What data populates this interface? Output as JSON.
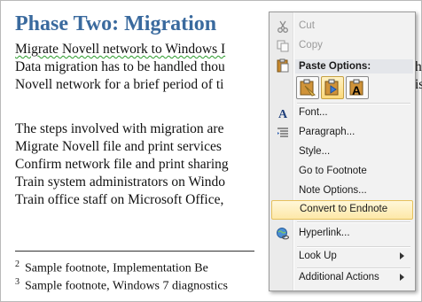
{
  "document": {
    "title": "Phase Two: Migration",
    "lines": [
      "Migrate Novell network to Windows I",
      "Data migration has to be handled thou",
      "Novell network for a brief period of ti",
      "",
      "The steps involved with migration are",
      "Migrate Novell file and print services",
      "Confirm network file and print sharing",
      "Train system administrators on Windo",
      "Train office staff on Microsoft Office,"
    ],
    "right_fragments": [
      "hi",
      "is"
    ],
    "footnotes": [
      {
        "num": "2",
        "text": "Sample footnote, Implementation Be"
      },
      {
        "num": "3",
        "text": "Sample footnote, Windows 7 diagnostics"
      }
    ]
  },
  "menu": {
    "cut": "Cut",
    "copy": "Copy",
    "paste_header": "Paste Options:",
    "font": "Font...",
    "paragraph": "Paragraph...",
    "style": "Style...",
    "goto_footnote": "Go to Footnote",
    "note_options": "Note Options...",
    "convert_endnote": "Convert to Endnote",
    "hyperlink": "Hyperlink...",
    "lookup": "Look Up",
    "additional_actions": "Additional Actions"
  },
  "icons": {
    "cut": "scissors-icon",
    "copy": "copy-icon",
    "paste": "clipboard-icon",
    "font": "font-a-icon",
    "paragraph": "paragraph-icon",
    "hyperlink": "globe-link-icon"
  },
  "colors": {
    "title": "#3a6a9e",
    "highlight": "#fde8a8",
    "menu_bg": "#f2f2f2"
  }
}
